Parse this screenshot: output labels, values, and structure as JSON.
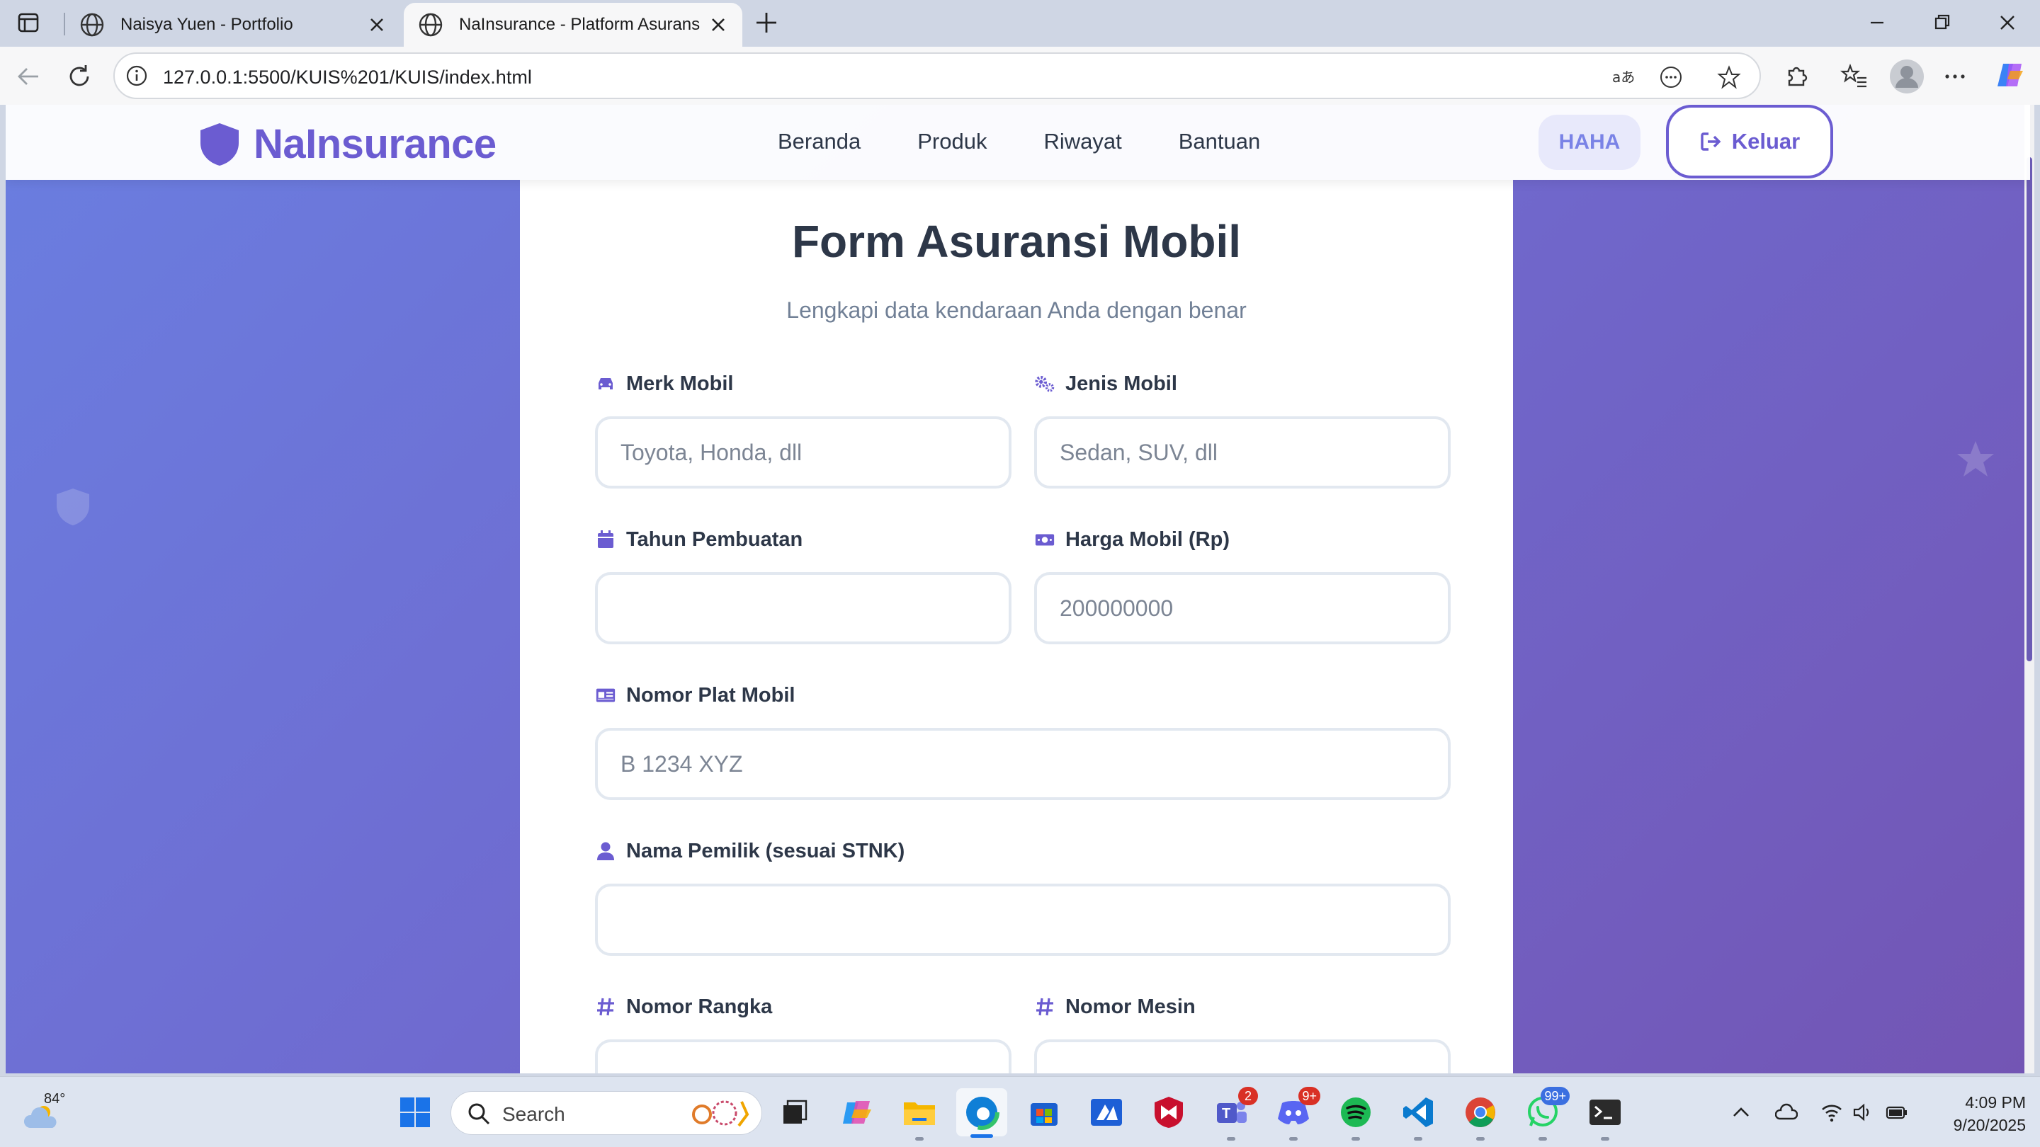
{
  "browser": {
    "tabs": [
      {
        "title": "Naisya Yuen - Portfolio",
        "active": false
      },
      {
        "title": "NaInsurance - Platform Asuransi T",
        "active": true
      }
    ],
    "url": "127.0.0.1:5500/KUIS%201/KUIS/index.html"
  },
  "site": {
    "brand": "NaInsurance",
    "menu": [
      "Beranda",
      "Produk",
      "Riwayat",
      "Bantuan"
    ],
    "user": "HAHA",
    "logout": "Keluar",
    "accent": "#6b5cd1"
  },
  "form": {
    "title": "Form Asuransi Mobil",
    "subtitle": "Lengkapi data kendaraan Anda dengan benar",
    "fields": {
      "merk": {
        "label": "Merk Mobil",
        "placeholder": "Toyota, Honda, dll",
        "icon": "car-icon"
      },
      "jenis": {
        "label": "Jenis Mobil",
        "placeholder": "Sedan, SUV, dll",
        "icon": "cogs-icon"
      },
      "tahun": {
        "label": "Tahun Pembuatan",
        "placeholder": "",
        "icon": "calendar-icon"
      },
      "harga": {
        "label": "Harga Mobil (Rp)",
        "placeholder": "200000000",
        "icon": "money-icon"
      },
      "plat": {
        "label": "Nomor Plat Mobil",
        "placeholder": "B 1234 XYZ",
        "icon": "id-card-icon"
      },
      "pemilik": {
        "label": "Nama Pemilik (sesuai STNK)",
        "placeholder": "",
        "icon": "user-icon"
      },
      "rangka": {
        "label": "Nomor Rangka",
        "placeholder": "",
        "icon": "hash-icon"
      },
      "mesin": {
        "label": "Nomor Mesin",
        "placeholder": "",
        "icon": "hash-icon"
      }
    }
  },
  "taskbar": {
    "weather_temp": "84°",
    "search": "Search",
    "badges": {
      "teams": "2",
      "discord": "9+",
      "whatsapp": "99+"
    },
    "time": "4:09 PM",
    "date": "9/20/2025"
  }
}
